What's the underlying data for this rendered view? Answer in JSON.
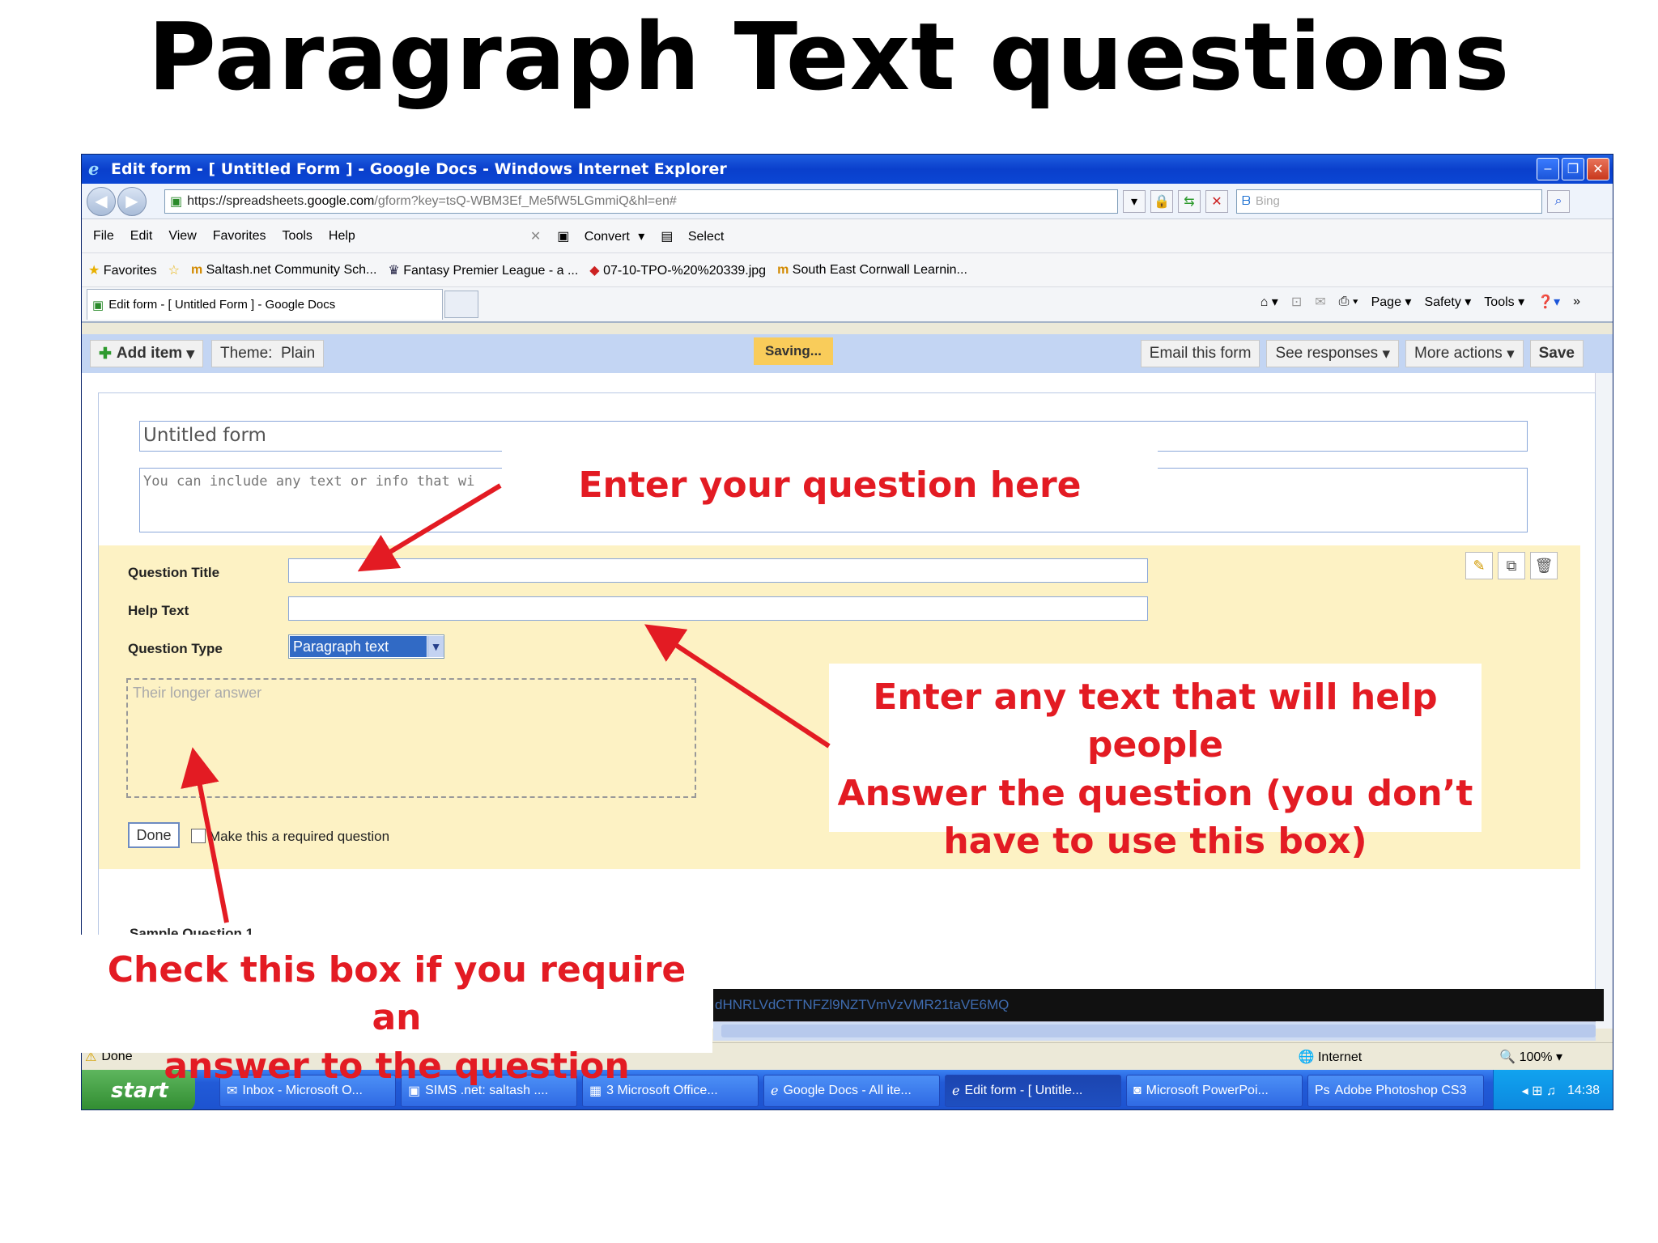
{
  "slide_title": "Paragraph Text questions",
  "browser": {
    "title": "Edit form - [ Untitled Form ] - Google Docs - Windows Internet Explorer",
    "url_prefix": "https://spreadsheets.",
    "url_domain": "google.com",
    "url_rest": "/gform?key=tsQ-WBM3Ef_Me5fW5LGmmiQ&hl=en#",
    "search_placeholder": "Bing",
    "menu": [
      "File",
      "Edit",
      "View",
      "Favorites",
      "Tools",
      "Help"
    ],
    "convert": "Convert",
    "select": "Select",
    "favorites_label": "Favorites",
    "favorites": [
      "Saltash.net Community Sch...",
      "Fantasy Premier League - a ...",
      "07-10-TPO-%20%20339.jpg",
      "South East Cornwall Learnin..."
    ],
    "tab_label": "Edit form - [ Untitled Form ] - Google Docs",
    "cmd": [
      "Page",
      "Safety",
      "Tools"
    ]
  },
  "form_toolbar": {
    "add_item": "Add item",
    "theme": "Theme:  Plain",
    "saving": "Saving...",
    "email": "Email this form",
    "responses": "See responses",
    "more": "More actions",
    "save": "Save"
  },
  "form": {
    "title": "Untitled form",
    "description": "You can include any text or info that wi",
    "question_title_label": "Question Title",
    "help_text_label": "Help Text",
    "question_type_label": "Question Type",
    "question_type_value": "Paragraph text",
    "answer_placeholder": "Their longer answer",
    "done": "Done",
    "required_label": "Make this a required question",
    "sample_question": "Sample Question 1",
    "dark_bar_text": "dHNRLVdCTTNFZl9NZTVmVzVMR21taVE6MQ"
  },
  "status": {
    "done": "Done",
    "zone": "Internet",
    "zoom": "100%"
  },
  "taskbar": {
    "start": "start",
    "buttons": [
      "Inbox - Microsoft O...",
      "SIMS .net: saltash ....",
      "3 Microsoft Office...",
      "Google Docs - All ite...",
      "Edit form - [ Untitle...",
      "Microsoft PowerPoi...",
      "Adobe Photoshop CS3"
    ],
    "clock": "14:38"
  },
  "callouts": {
    "question": "Enter your question here",
    "help_line1": "Enter any text that will help people",
    "help_line2": "Answer the question (you don’t",
    "help_line3": "have to use this box)",
    "required_line1": "Check this box if you require an",
    "required_line2": "answer to the question"
  },
  "colors": {
    "callout_text": "#e31b23",
    "arrow": "#e31b23"
  }
}
